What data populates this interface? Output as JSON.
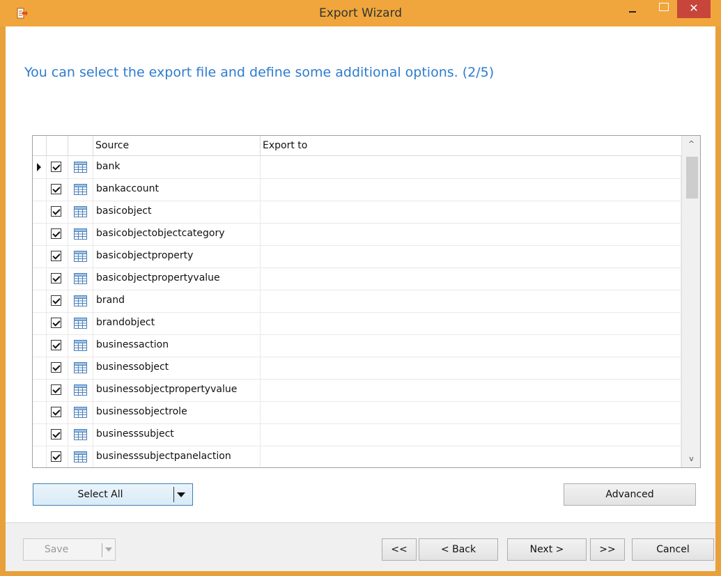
{
  "window": {
    "title": "Export Wizard",
    "close_glyph": "✕",
    "accent_color": "#f0a63c",
    "close_color": "#c7453a"
  },
  "heading": "You can select the export file and define some additional options. (2/5)",
  "grid": {
    "columns": {
      "source": "Source",
      "export_to": "Export to"
    },
    "rows": [
      {
        "source": "bank",
        "export_to": "",
        "checked": true,
        "current": true
      },
      {
        "source": "bankaccount",
        "export_to": "",
        "checked": true
      },
      {
        "source": "basicobject",
        "export_to": "",
        "checked": true
      },
      {
        "source": "basicobjectobjectcategory",
        "export_to": "",
        "checked": true
      },
      {
        "source": "basicobjectproperty",
        "export_to": "",
        "checked": true
      },
      {
        "source": "basicobjectpropertyvalue",
        "export_to": "",
        "checked": true
      },
      {
        "source": "brand",
        "export_to": "",
        "checked": true
      },
      {
        "source": "brandobject",
        "export_to": "",
        "checked": true
      },
      {
        "source": "businessaction",
        "export_to": "",
        "checked": true
      },
      {
        "source": "businessobject",
        "export_to": "",
        "checked": true
      },
      {
        "source": "businessobjectpropertyvalue",
        "export_to": "",
        "checked": true
      },
      {
        "source": "businessobjectrole",
        "export_to": "",
        "checked": true
      },
      {
        "source": "businesssubject",
        "export_to": "",
        "checked": true
      },
      {
        "source": "businesssubjectpanelaction",
        "export_to": "",
        "checked": true
      }
    ]
  },
  "buttons": {
    "select_all": "Select All",
    "advanced": "Advanced",
    "save": "Save",
    "first": "<<",
    "back": "< Back",
    "next": "Next >",
    "last": ">>",
    "cancel": "Cancel"
  },
  "scroll": {
    "up_glyph": "^",
    "down_glyph": "v"
  }
}
